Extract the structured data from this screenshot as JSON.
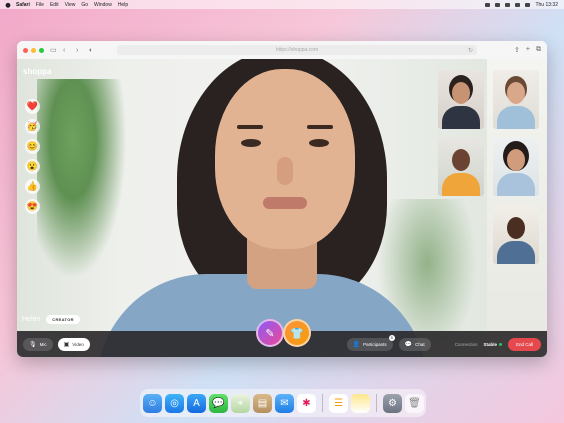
{
  "menubar": {
    "app": "Safari",
    "items": [
      "File",
      "Edit",
      "View",
      "Go",
      "Window",
      "Help"
    ],
    "clock": "Thu 13:32"
  },
  "browser": {
    "url": "https://shoppa.com"
  },
  "stream": {
    "brand": "shoppa",
    "host_name": "Helen",
    "host_badge": "CREATOR",
    "reactions": [
      "❤️",
      "🥳",
      "😊",
      "😮",
      "👍",
      "😍"
    ],
    "participant_count": "5"
  },
  "controls": {
    "mic_label": "Mic",
    "video_label": "Video",
    "participants_label": "Participants",
    "chat_label": "Chat",
    "connection_label": "Connection",
    "connection_value": "Stable",
    "end_call_label": "End Call"
  },
  "colors": {
    "end_call": "#e5484d",
    "connection_ok": "#22c55e",
    "pen_gradient": "#8b5cf6",
    "shop_gradient": "#fb923c"
  },
  "dock": {
    "apps": [
      "finder",
      "safari",
      "app-store",
      "messages",
      "maps",
      "notes-folder",
      "mail",
      "slack",
      "reminders",
      "notes",
      "system-settings",
      "trash"
    ]
  }
}
